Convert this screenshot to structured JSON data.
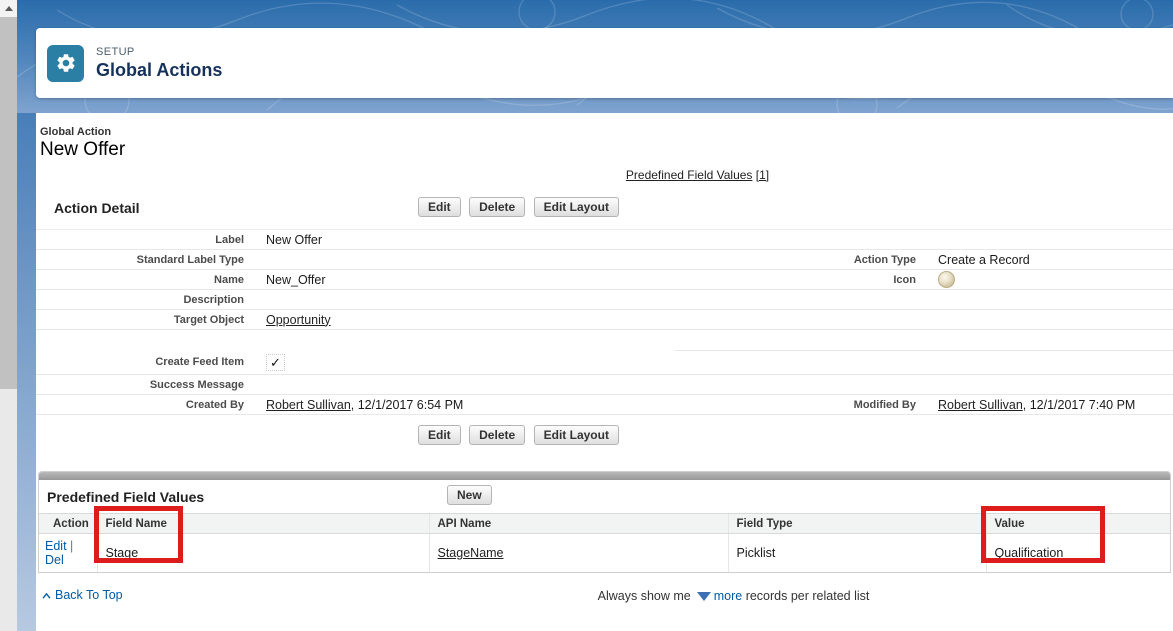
{
  "colors": {
    "link_blue": "#015ba7",
    "title_navy": "#16325c",
    "setup_tile_teal": "#2b7fa5",
    "annotation_red": "#dd1c1c"
  },
  "setup_header": {
    "eyebrow": "SETUP",
    "title": "Global Actions"
  },
  "record_header": {
    "type_label": "Global Action",
    "title": "New Offer"
  },
  "jump_links": {
    "label": "Predefined Field Values",
    "count": "[1]"
  },
  "detail": {
    "section_title": "Action Detail",
    "buttons": {
      "edit": "Edit",
      "delete": "Delete",
      "edit_layout": "Edit Layout"
    },
    "rows": [
      {
        "left_label": "Label",
        "left_value": "New Offer",
        "right_label": "",
        "right_value": ""
      },
      {
        "left_label": "Standard Label Type",
        "left_value": "",
        "right_label": "Action Type",
        "right_value": "Create a Record"
      },
      {
        "left_label": "Name",
        "left_value": "New_Offer",
        "right_label": "Icon"
      },
      {
        "left_label": "Description",
        "left_value": "",
        "right_label": "",
        "right_value": ""
      },
      {
        "left_label": "Target Object",
        "left_link": "Opportunity",
        "right_label": "",
        "right_value": ""
      },
      {
        "left_label": "Create Feed Item",
        "check_glyph": "✓",
        "right_label": ""
      },
      {
        "left_label": "Success Message",
        "left_value": "",
        "right_label": "",
        "right_value": ""
      },
      {
        "left_label": "Created By",
        "left_link": "Robert Sullivan",
        "left_suffix": ", 12/1/2017 6:54 PM",
        "right_label": "Modified By",
        "right_link": "Robert Sullivan",
        "right_suffix": ", 12/1/2017 7:40 PM"
      }
    ]
  },
  "related_list": {
    "title": "Predefined Field Values",
    "new_button": "New",
    "columns": [
      "Action",
      "Field Name",
      "API Name",
      "Field Type",
      "Value"
    ],
    "rows": [
      {
        "action_edit": "Edit",
        "action_sep": " | ",
        "action_del": "Del",
        "field_name": "Stage",
        "api_name": "StageName",
        "field_type": "Picklist",
        "value": "Qualification"
      }
    ]
  },
  "footer": {
    "back_to_top": "Back To Top",
    "always_prefix": "Always show me",
    "more_link": "more",
    "always_suffix": "records per related list"
  }
}
